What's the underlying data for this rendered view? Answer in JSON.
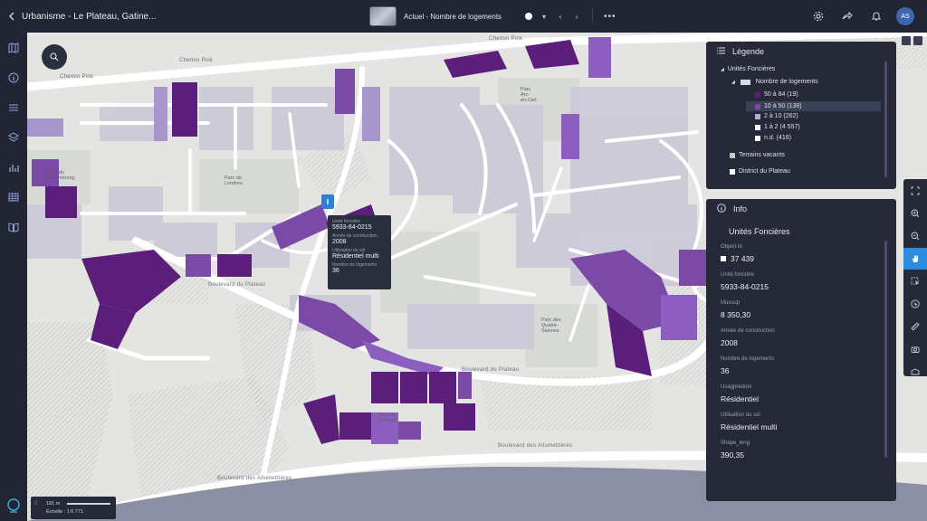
{
  "header": {
    "app_title": "Urbanisme - Le Plateau, Gatine...",
    "map_name": "Actuel - Nombre de logements",
    "user_initials": "AS"
  },
  "map": {
    "roads": {
      "chemin_pink_1": "Chemin Pink",
      "chemin_pink_2": "Chemin Pink",
      "chemin_pink_3": "Chemin Pink",
      "boulevard_plateau_1": "Boulevard du Plateau",
      "boulevard_plateau_2": "Boulevard du Plateau",
      "boulevard_allumettieres_1": "Boulevard des Allumettières",
      "boulevard_allumettieres_2": "Boulevard des Allumettières"
    },
    "places": {
      "parc_luxembourg": "Parc du\nLuxembourg",
      "parc_londres": "Parc de\nLondres",
      "parc_arc_en_ciel": "Parc\nArc-\nen-Ciel",
      "parc_quatre_saisons": "Parc des\nQuatre-\nSaisons",
      "parc_brouage": "Parc de\nBrouage"
    }
  },
  "tooltip": {
    "k1": "Unité foncière",
    "v1": "5933-84-0215",
    "k2": "Année de construction",
    "v2": "2008",
    "k3": "Utilisation du sol",
    "v3": "Résidentiel multi",
    "k4": "Nombre de logements",
    "v4": "36"
  },
  "legend": {
    "title": "Légende",
    "group": "Unités Foncières",
    "layer": "Nombre de logements",
    "classes": [
      {
        "label": "50 à 84 (19)",
        "color": "#5b1e7a"
      },
      {
        "label": "10 à 50 (138)",
        "color": "#7a4aa6"
      },
      {
        "label": "2 à 10 (262)",
        "color": "#b7a8d4"
      },
      {
        "label": "1 à 2 (4 557)",
        "color": "#ffffff"
      },
      {
        "label": "n.d. (416)",
        "color": "#ffffff"
      }
    ],
    "vacant": "Terrains vacants",
    "district": "District du Plateau"
  },
  "info": {
    "title": "Info",
    "subtitle": "Unités Foncières",
    "fields": [
      {
        "key": "Object id",
        "value": "37 439"
      },
      {
        "key": "Unité foncière",
        "value": "5933-84-0215"
      },
      {
        "key": "Mussup",
        "value": "8 350,30"
      },
      {
        "key": "Année de construction",
        "value": "2008"
      },
      {
        "key": "Nombre de logements",
        "value": "36"
      },
      {
        "key": "Usagpredom",
        "value": "Résidentiel"
      },
      {
        "key": "Utilisation du sol",
        "value": "Résidentiel multi"
      },
      {
        "key": "Shape_leng",
        "value": "390,35"
      }
    ]
  },
  "scale": {
    "distance": "181 m",
    "ratio": "Échelle : 1:6 771"
  }
}
